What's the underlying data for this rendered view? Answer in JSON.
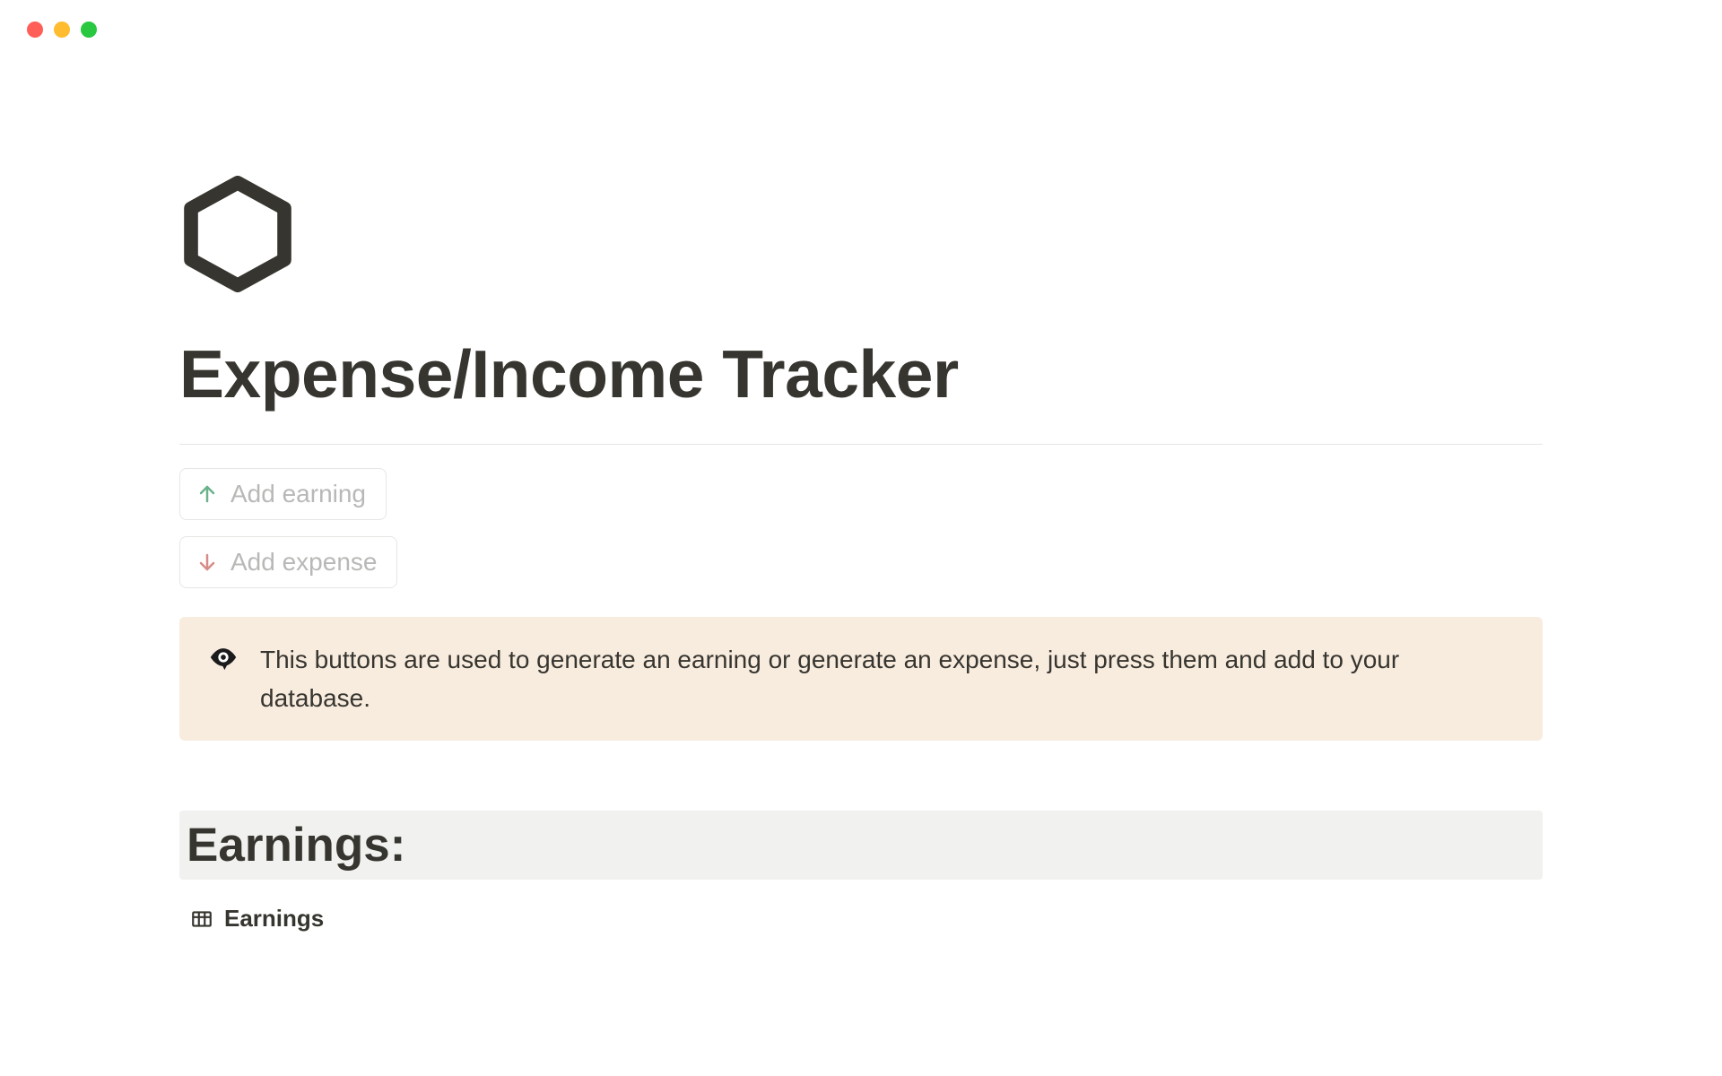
{
  "page": {
    "title": "Expense/Income Tracker",
    "icon_name": "hexagon-icon"
  },
  "actions": {
    "add_earning_label": "Add earning",
    "add_expense_label": "Add expense"
  },
  "callout": {
    "text": "This buttons are used to generate an earning or generate an expense, just press them and add to your database."
  },
  "earnings": {
    "heading": "Earnings:",
    "view_label": "Earnings"
  },
  "colors": {
    "text_primary": "#37352f",
    "border": "#e6e6e4",
    "callout_bg": "#f8ecdf",
    "section_bg": "#f1f1ef",
    "arrow_up": "#6ab28a",
    "arrow_down": "#d68b87"
  }
}
